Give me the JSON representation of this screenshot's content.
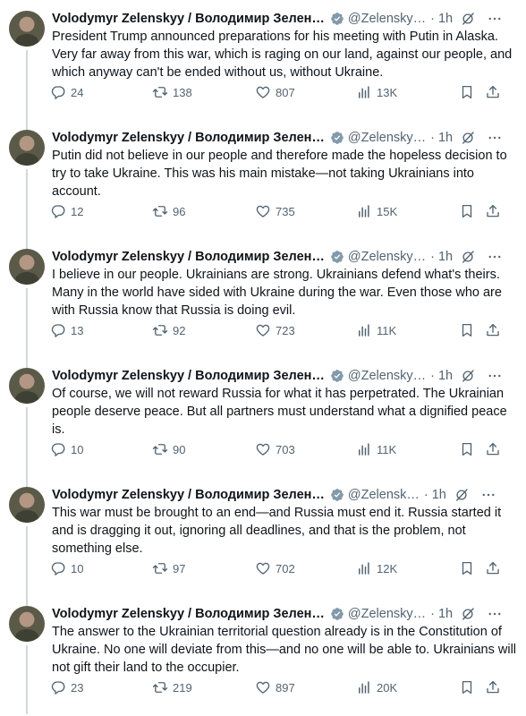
{
  "author": {
    "name": "Volodymyr Zelenskyy / Володимир Зелен…",
    "handle": "@Zelensky…",
    "time": "1h"
  },
  "icons": {
    "verified": "verified-badge-icon",
    "grok": "grok-icon",
    "more": "more-options-icon",
    "reply": "reply-icon",
    "retweet": "retweet-icon",
    "like": "like-icon",
    "views": "views-icon",
    "bookmark": "bookmark-icon",
    "share": "share-icon"
  },
  "colors": {
    "verified": "#1d9bf0",
    "text": "#0f1419",
    "muted": "#536471",
    "thread_line": "#cfd9de"
  },
  "tweets": [
    {
      "handle": "@Zelensky…",
      "text": "President Trump announced preparations for his meeting with Putin in Alaska. Very far away from this war, which is raging on our land, against our people, and which anyway can't be ended without us, without Ukraine.",
      "replies": "24",
      "retweets": "138",
      "likes": "807",
      "views": "13K"
    },
    {
      "handle": "@Zelensky…",
      "text": "Putin did not believe in our people and therefore made the hopeless decision to try to take Ukraine. This was his main mistake—not taking Ukrainians into account.",
      "replies": "12",
      "retweets": "96",
      "likes": "735",
      "views": "15K"
    },
    {
      "handle": "@Zelensky…",
      "text": "I believe in our people. Ukrainians are strong. Ukrainians defend what's theirs. Many in the world have sided with Ukraine during the war. Even those who are with Russia know that Russia is doing evil.",
      "replies": "13",
      "retweets": "92",
      "likes": "723",
      "views": "11K"
    },
    {
      "handle": "@Zelensky…",
      "text": "Of course, we will not reward Russia for what it has perpetrated. The Ukrainian people deserve peace. But all partners must understand what a dignified peace is.",
      "replies": "10",
      "retweets": "90",
      "likes": "703",
      "views": "11K"
    },
    {
      "handle": "@Zelensk…",
      "text": "This war must be brought to an end—and Russia must end it. Russia started it and is dragging it out, ignoring all deadlines, and that is the problem, not something else.",
      "replies": "10",
      "retweets": "97",
      "likes": "702",
      "views": "12K"
    },
    {
      "handle": "@Zelensky…",
      "text": "The answer to the Ukrainian territorial question already is in the Constitution of Ukraine. No one will deviate from this—and no one will be able to. Ukrainians will not gift their land to the occupier.",
      "replies": "23",
      "retweets": "219",
      "likes": "897",
      "views": "20K"
    }
  ]
}
